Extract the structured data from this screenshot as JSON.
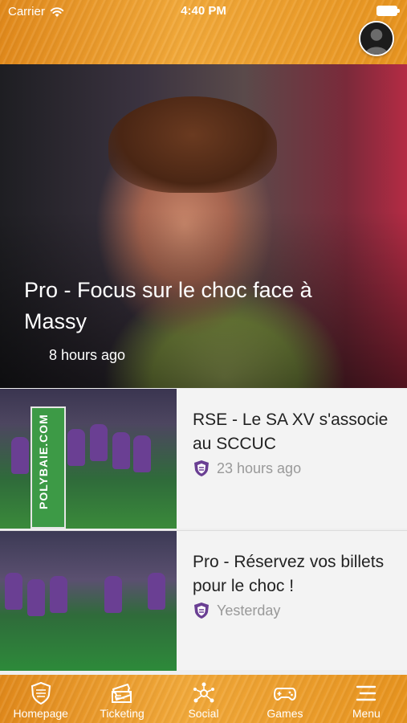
{
  "status_bar": {
    "carrier": "Carrier",
    "time": "4:40 PM"
  },
  "hero": {
    "title": "Pro - Focus sur le choc face à Massy",
    "time": "8 hours ago"
  },
  "articles": [
    {
      "title": "RSE - Le SA XV s'associe au SCCUC",
      "time": "23 hours ago",
      "thumb_text": "POLYBAIE.COM"
    },
    {
      "title": "Pro - Réservez vos billets pour le choc !",
      "time": "Yesterday"
    }
  ],
  "tabs": [
    {
      "label": "Homepage",
      "icon": "club-shield-icon"
    },
    {
      "label": "Ticketing",
      "icon": "ticket-icon"
    },
    {
      "label": "Social",
      "icon": "network-icon"
    },
    {
      "label": "Games",
      "icon": "gamepad-icon"
    },
    {
      "label": "Menu",
      "icon": "hamburger-icon"
    }
  ],
  "colors": {
    "accent_orange": "#E8941F",
    "club_purple": "#6A3F93",
    "meta_gray": "#999999"
  }
}
